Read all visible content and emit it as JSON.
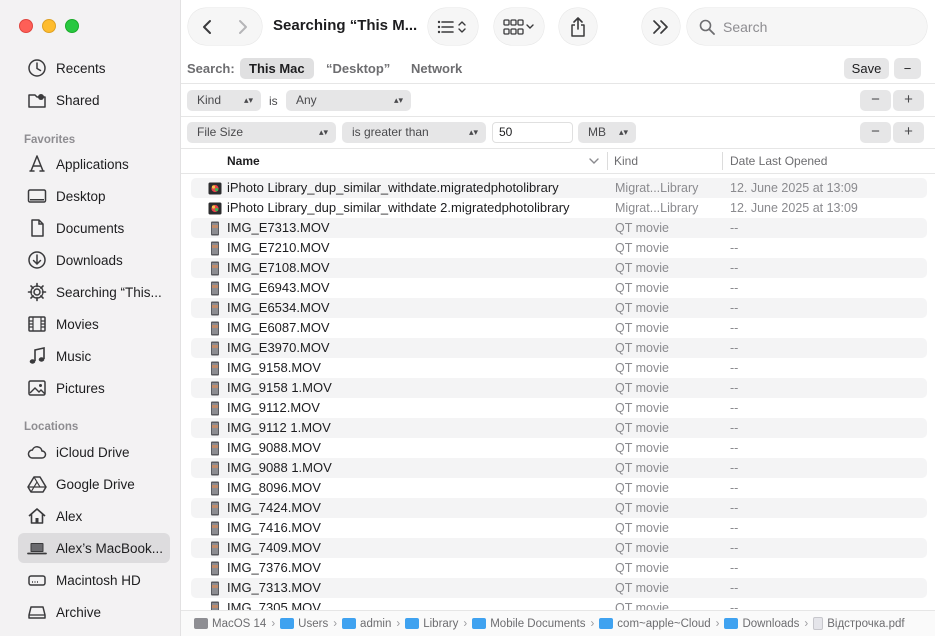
{
  "window": {
    "title": "Searching “This M..."
  },
  "toolbar": {
    "search_placeholder": "Search"
  },
  "sidebar": {
    "recents": [
      {
        "label": "Recents",
        "icon": "clock-icon"
      },
      {
        "label": "Shared",
        "icon": "shared-folder-icon"
      }
    ],
    "favorites_title": "Favorites",
    "favorites": [
      {
        "label": "Applications",
        "icon": "applications-icon"
      },
      {
        "label": "Desktop",
        "icon": "desktop-icon"
      },
      {
        "label": "Documents",
        "icon": "document-icon"
      },
      {
        "label": "Downloads",
        "icon": "downloads-icon"
      },
      {
        "label": "Searching “This...",
        "icon": "gear-icon"
      },
      {
        "label": "Movies",
        "icon": "film-icon"
      },
      {
        "label": "Music",
        "icon": "music-note-icon"
      },
      {
        "label": "Pictures",
        "icon": "photo-icon"
      }
    ],
    "locations_title": "Locations",
    "locations": [
      {
        "label": "iCloud Drive",
        "icon": "cloud-icon"
      },
      {
        "label": "Google Drive",
        "icon": "google-drive-icon"
      },
      {
        "label": "Alex",
        "icon": "home-icon"
      },
      {
        "label": "Alex’s MacBook...",
        "icon": "laptop-icon",
        "selected": true
      },
      {
        "label": "Macintosh HD",
        "icon": "hard-drive-icon"
      },
      {
        "label": "Archive",
        "icon": "external-drive-icon"
      }
    ]
  },
  "scope": {
    "label": "Search:",
    "options": [
      "This Mac",
      "“Desktop”",
      "Network"
    ],
    "active": "This Mac",
    "save": "Save",
    "minus": "−"
  },
  "criteria": [
    {
      "attribute": "Kind",
      "connector": "is",
      "operator": "Any",
      "minus": "−",
      "plus": "+"
    },
    {
      "attribute": "File Size",
      "operator": "is greater than",
      "value": "50",
      "unit": "MB",
      "minus": "−",
      "plus": "+"
    }
  ],
  "columns": {
    "name": "Name",
    "kind": "Kind",
    "date": "Date Last Opened"
  },
  "files": [
    {
      "name": "iPhoto Library_dup_similar_withdate.migratedphotolibrary",
      "kind": "Migrat...Library",
      "date": "12. June 2025 at 13:09",
      "icon": "photo-library-icon"
    },
    {
      "name": "iPhoto Library_dup_similar_withdate 2.migratedphotolibrary",
      "kind": "Migrat...Library",
      "date": "12. June 2025 at 13:09",
      "icon": "photo-library-icon"
    },
    {
      "name": "IMG_E7313.MOV",
      "kind": "QT movie",
      "date": "--",
      "icon": "movie-file-icon"
    },
    {
      "name": "IMG_E7210.MOV",
      "kind": "QT movie",
      "date": "--",
      "icon": "movie-file-icon"
    },
    {
      "name": "IMG_E7108.MOV",
      "kind": "QT movie",
      "date": "--",
      "icon": "movie-file-icon"
    },
    {
      "name": "IMG_E6943.MOV",
      "kind": "QT movie",
      "date": "--",
      "icon": "movie-file-icon"
    },
    {
      "name": "IMG_E6534.MOV",
      "kind": "QT movie",
      "date": "--",
      "icon": "movie-file-icon"
    },
    {
      "name": "IMG_E6087.MOV",
      "kind": "QT movie",
      "date": "--",
      "icon": "movie-file-icon"
    },
    {
      "name": "IMG_E3970.MOV",
      "kind": "QT movie",
      "date": "--",
      "icon": "movie-file-icon"
    },
    {
      "name": "IMG_9158.MOV",
      "kind": "QT movie",
      "date": "--",
      "icon": "movie-file-icon"
    },
    {
      "name": "IMG_9158 1.MOV",
      "kind": "QT movie",
      "date": "--",
      "icon": "movie-file-icon"
    },
    {
      "name": "IMG_9112.MOV",
      "kind": "QT movie",
      "date": "--",
      "icon": "movie-file-icon"
    },
    {
      "name": "IMG_9112 1.MOV",
      "kind": "QT movie",
      "date": "--",
      "icon": "movie-file-icon"
    },
    {
      "name": "IMG_9088.MOV",
      "kind": "QT movie",
      "date": "--",
      "icon": "movie-file-icon"
    },
    {
      "name": "IMG_9088 1.MOV",
      "kind": "QT movie",
      "date": "--",
      "icon": "movie-file-icon"
    },
    {
      "name": "IMG_8096.MOV",
      "kind": "QT movie",
      "date": "--",
      "icon": "movie-file-icon"
    },
    {
      "name": "IMG_7424.MOV",
      "kind": "QT movie",
      "date": "--",
      "icon": "movie-file-icon"
    },
    {
      "name": "IMG_7416.MOV",
      "kind": "QT movie",
      "date": "--",
      "icon": "movie-file-icon"
    },
    {
      "name": "IMG_7409.MOV",
      "kind": "QT movie",
      "date": "--",
      "icon": "movie-file-icon"
    },
    {
      "name": "IMG_7376.MOV",
      "kind": "QT movie",
      "date": "--",
      "icon": "movie-file-icon"
    },
    {
      "name": "IMG_7313.MOV",
      "kind": "QT movie",
      "date": "--",
      "icon": "movie-file-icon"
    },
    {
      "name": "IMG_7305.MOV",
      "kind": "QT movie",
      "date": "--",
      "icon": "movie-file-icon"
    }
  ],
  "path": [
    {
      "label": "MacOS 14",
      "icon": "drive-icon"
    },
    {
      "label": "Users",
      "icon": "folder-icon"
    },
    {
      "label": "admin",
      "icon": "folder-icon"
    },
    {
      "label": "Library",
      "icon": "folder-icon"
    },
    {
      "label": "Mobile Documents",
      "icon": "folder-icon"
    },
    {
      "label": "com~apple~Cloud",
      "icon": "folder-icon"
    },
    {
      "label": "Downloads",
      "icon": "folder-icon"
    },
    {
      "label": "Відстрочка.pdf",
      "icon": "pdf-file-icon"
    }
  ],
  "colors": {
    "accent": "#2f7cf6",
    "folder": "#3fa2f0",
    "close": "#fe5f57",
    "minimize": "#febc2e",
    "zoom": "#28c840"
  }
}
